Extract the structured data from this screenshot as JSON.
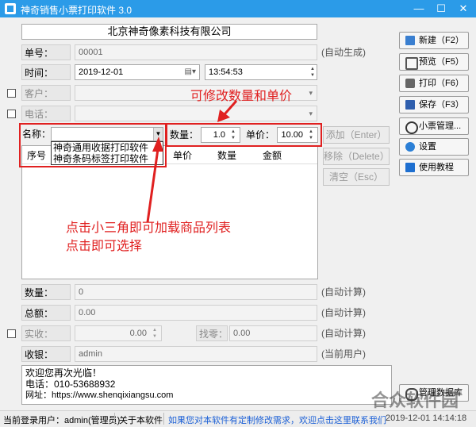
{
  "window": {
    "title": "神奇销售小票打印软件 3.0",
    "minimize": "—",
    "maximize": "☐",
    "close": "✕"
  },
  "form": {
    "company": "北京神奇像素科技有限公司",
    "order_no_label": "单号：",
    "order_no": "00001",
    "order_no_note": "(自动生成)",
    "time_label": "时间：",
    "date": "2019-12-01",
    "time": "13:54:53",
    "customer_label": "客户：",
    "phone_label": "电话：",
    "name_label": "名称：",
    "name_value": "",
    "name_options": [
      "神奇通用收据打印软件",
      "神奇条码标签打印软件"
    ],
    "qty_label": "数量：",
    "qty_value": "1.0",
    "price_label": "单价：",
    "price_value": "10.00"
  },
  "table": {
    "columns": [
      "序号",
      "",
      "单价",
      "数量",
      "金额"
    ]
  },
  "item_buttons": {
    "add": "添加（Enter）",
    "remove": "移除（Delete）",
    "clear": "清空（Esc）"
  },
  "summary": {
    "count_label": "数量：",
    "count_value": "0",
    "count_note": "(自动计算)",
    "total_label": "总额：",
    "total_value": "0.00",
    "total_note": "(自动计算)",
    "received_label": "实收：",
    "received_value": "0.00",
    "change_label": "找零：",
    "change_value": "0.00",
    "change_note": "(自动计算)",
    "cashier_label": "收银：",
    "cashier_value": "admin",
    "cashier_note": "(当前用户)"
  },
  "footer_text": {
    "line1": "欢迎您再次光临！",
    "line2": "电话：010-53688932",
    "line3": "网址：https://www.shenqixiangsu.com"
  },
  "sidebar": {
    "new": "新建（F2）",
    "preview": "预览（F5）",
    "print": "打印（F6）",
    "save": "保存（F3）",
    "manage": "小票管理...",
    "settings": "设置",
    "tutorial": "使用教程",
    "db": "管理数据库"
  },
  "annotations": {
    "top": "可修改数量和单价",
    "bottom1": "点击小三角即可加载商品列表",
    "bottom2": "点击即可选择"
  },
  "status_bar": {
    "user": "当前登录用户：admin(管理员)",
    "about": "关于本软件",
    "link": "如果您对本软件有定制修改需求，欢迎点击这里联系我们",
    "datetime": "2019-12-01 14:14:18"
  },
  "watermark": "合众软件园",
  "colors": {
    "titlebar": "#2b9be8",
    "annotation": "#e02020",
    "link": "#1a5fd6"
  }
}
